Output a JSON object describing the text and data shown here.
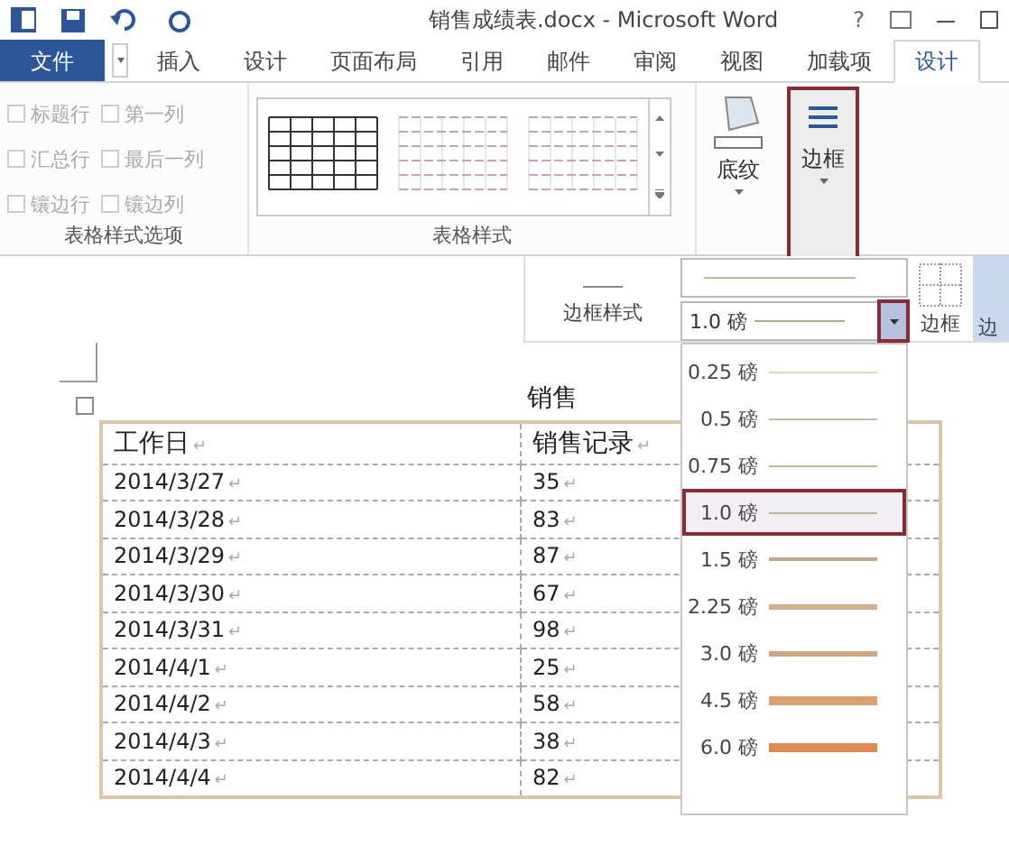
{
  "window": {
    "title": "销售成绩表.docx - Microsoft Word",
    "help": "?"
  },
  "tabs": [
    {
      "label": "文件",
      "kind": "file",
      "selected": false
    },
    {
      "label": "插入",
      "kind": "tab",
      "selected": false
    },
    {
      "label": "设计",
      "kind": "tab",
      "selected": false
    },
    {
      "label": "页面布局",
      "kind": "tab",
      "selected": false
    },
    {
      "label": "引用",
      "kind": "tab",
      "selected": false
    },
    {
      "label": "邮件",
      "kind": "tab",
      "selected": false
    },
    {
      "label": "审阅",
      "kind": "tab",
      "selected": false
    },
    {
      "label": "视图",
      "kind": "tab",
      "selected": false
    },
    {
      "label": "加载项",
      "kind": "tab",
      "selected": false
    },
    {
      "label": "设计",
      "kind": "tab",
      "selected": true
    }
  ],
  "style_options": {
    "label": "表格样式选项",
    "items": [
      {
        "label": "标题行",
        "checked": false
      },
      {
        "label": "第一列",
        "checked": false
      },
      {
        "label": "汇总行",
        "checked": false
      },
      {
        "label": "最后一列",
        "checked": false
      },
      {
        "label": "镶边行",
        "checked": false
      },
      {
        "label": "镶边列",
        "checked": false
      }
    ]
  },
  "table_styles": {
    "label": "表格样式"
  },
  "shading": {
    "label": "底纹"
  },
  "borders": {
    "label": "边框",
    "highlighted": true
  },
  "border_panel": {
    "style_label": "边框样式",
    "weight": "1.0 磅",
    "weight_arrow_highlighted": true,
    "borders_label": "边框",
    "painter_label": "边"
  },
  "weight_menu": [
    {
      "label": "0.25 磅",
      "kind": "hairline",
      "color": "#e8d6b8",
      "selected": false
    },
    {
      "label": "0.5 磅",
      "kind": "hairline",
      "color": "#c9bba4",
      "selected": false
    },
    {
      "label": "0.75 磅",
      "kind": "thin",
      "color": "#c2b49a",
      "selected": false
    },
    {
      "label": "1.0 磅",
      "kind": "thin",
      "color": "#bfb29a",
      "selected": true
    },
    {
      "label": "1.5 磅",
      "kind": "medium",
      "color": "#bba98c",
      "selected": false
    },
    {
      "label": "2.25 磅",
      "kind": "thick",
      "color": "#d4b088",
      "selected": false
    },
    {
      "label": "3.0 磅",
      "kind": "thick",
      "color": "#d0a67c",
      "selected": false
    },
    {
      "label": "4.5 磅",
      "kind": "heavy",
      "color": "#d9a070",
      "selected": false
    },
    {
      "label": "6.0 磅",
      "kind": "heavy",
      "color": "#e08a50",
      "selected": false
    }
  ],
  "document": {
    "heading": "销售",
    "end_mark": "↵",
    "table": {
      "columns": [
        "工作日",
        "销售记录"
      ],
      "rows": [
        [
          "2014/3/27",
          "35"
        ],
        [
          "2014/3/28",
          "83"
        ],
        [
          "2014/3/29",
          "87"
        ],
        [
          "2014/3/30",
          "67"
        ],
        [
          "2014/3/31",
          "98"
        ],
        [
          "2014/4/1",
          "25"
        ],
        [
          "2014/4/2",
          "58"
        ],
        [
          "2014/4/3",
          "38"
        ],
        [
          "2014/4/4",
          "82"
        ]
      ]
    }
  }
}
